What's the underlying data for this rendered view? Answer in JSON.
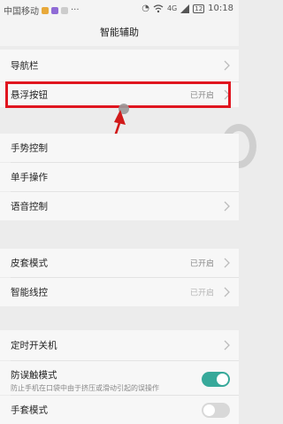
{
  "status_bar": {
    "carrier": "中国移动",
    "network": "4G",
    "battery": "12",
    "time": "10:18"
  },
  "header": {
    "title": "智能辅助"
  },
  "rows": [
    {
      "label": "导航栏",
      "status": ""
    },
    {
      "label": "悬浮按钮",
      "status": "已开启"
    },
    {
      "label": "手势控制",
      "status": ""
    },
    {
      "label": "单手操作",
      "status": ""
    },
    {
      "label": "语音控制",
      "status": ""
    },
    {
      "label": "皮套模式",
      "status": "已开启"
    },
    {
      "label": "智能线控",
      "status": "已开启"
    },
    {
      "label": "定时开关机",
      "status": ""
    },
    {
      "label": "防误触模式",
      "status": "",
      "subtitle": "防止手机在口袋中由于挤压或滑动引起的误操作"
    },
    {
      "label": "手套模式",
      "status": ""
    }
  ],
  "toggles": {
    "anti_mistouch": true,
    "glove_mode": false
  },
  "colors": {
    "accent": "#37a99a",
    "highlight": "#e0151f",
    "arrow": "#d11a1a"
  }
}
